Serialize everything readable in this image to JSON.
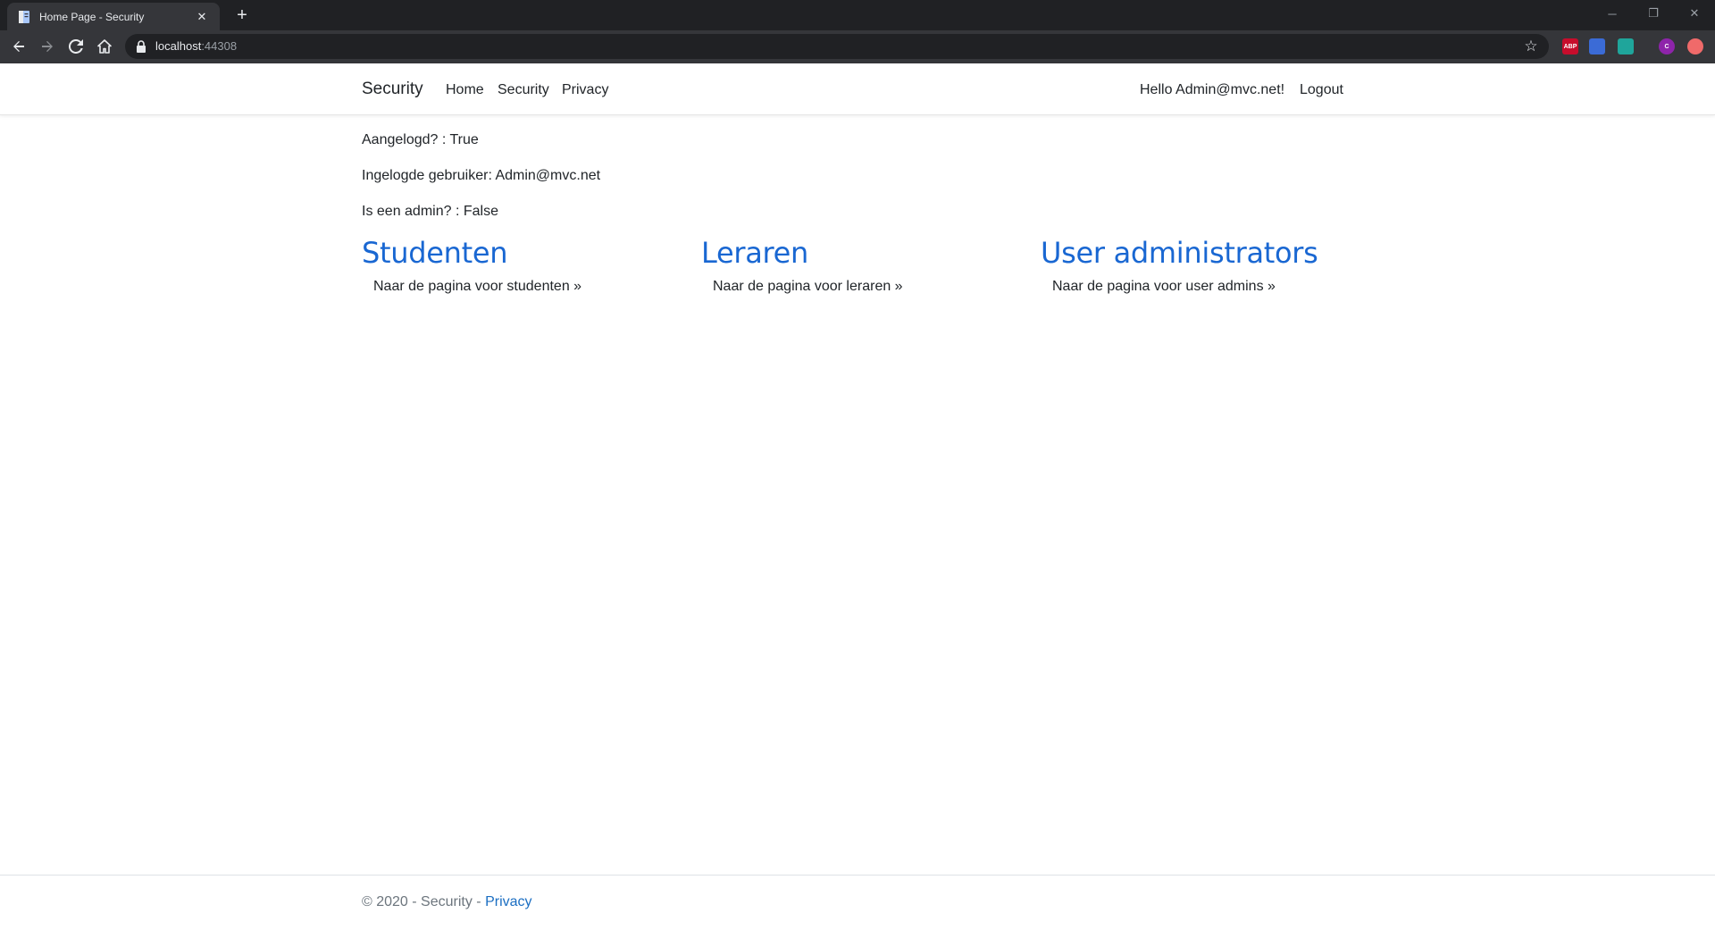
{
  "browser": {
    "tab_title": "Home Page - Security",
    "close_glyph": "✕",
    "new_tab_glyph": "+",
    "url_host": "localhost",
    "url_port": ":44308",
    "star_glyph": "☆",
    "window_controls": {
      "minimize": "─",
      "restore": "❐",
      "close": "✕"
    },
    "extensions": [
      {
        "name": "adblock-plus",
        "label": "ABP",
        "color": "#c70d2c"
      },
      {
        "name": "cloud-extension",
        "label": "",
        "color": "#3b6bd6"
      },
      {
        "name": "teal-extension",
        "label": "",
        "color": "#1fa59b"
      },
      {
        "name": "profile-avatar",
        "label": "C",
        "color": "#8e24aa"
      },
      {
        "name": "red-extension",
        "label": "",
        "color": "#f06a6a"
      }
    ]
  },
  "navbar": {
    "brand": "Security",
    "links": [
      "Home",
      "Security",
      "Privacy"
    ],
    "greeting": "Hello Admin@mvc.net!",
    "logout": "Logout"
  },
  "info": {
    "logged_in": "Aangelogd? : True",
    "user": "Ingelogde gebruiker: Admin@mvc.net",
    "is_admin": "Is een admin? : False"
  },
  "sections": [
    {
      "title": "Studenten",
      "link": "Naar de pagina voor studenten »"
    },
    {
      "title": "Leraren",
      "link": "Naar de pagina voor leraren »"
    },
    {
      "title": "User administrators",
      "link": "Naar de pagina voor user admins »"
    }
  ],
  "footer": {
    "text": "© 2020 - Security - ",
    "privacy_link": "Privacy"
  },
  "colors": {
    "accent": "#1967d2",
    "footer_link": "#1b6ec2",
    "chrome_dark": "#202124",
    "chrome_mid": "#35363a"
  }
}
